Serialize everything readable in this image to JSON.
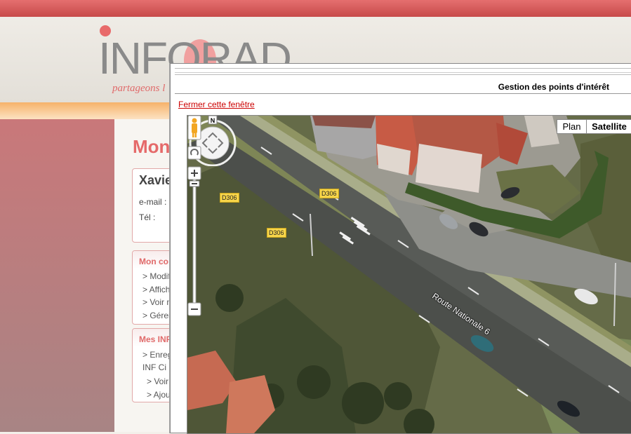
{
  "site": {
    "logo_text": "INFORAD",
    "tagline": "partageons l",
    "page_title": "Mon",
    "profile": {
      "name": "Xavie",
      "email_label": "e-mail :",
      "tel_label": "Tél :"
    },
    "account_box": {
      "title": "Mon co",
      "links": [
        "> Modif",
        "> Affich",
        "> Voir m",
        "> Gérer"
      ]
    },
    "inf_box": {
      "title": "Mes INF",
      "links": [
        "> Enreg",
        "INF Ci",
        "> Voir",
        "> Ajou"
      ]
    }
  },
  "popup": {
    "title": "Gestion des points d'intérêt",
    "close_link": "Fermer cette fenêtre"
  },
  "map": {
    "map_types": {
      "plan": "Plan",
      "satellite": "Satellite",
      "active": "Satellite"
    },
    "compass": "N",
    "road_labels": [
      "D306",
      "D306",
      "D306"
    ],
    "route_label": "Route Nationale 6",
    "marker_color": "#d9412b",
    "icons": [
      "pan-control-icon",
      "pegman-icon",
      "rotate-icon",
      "zoom-in-icon",
      "zoom-out-icon",
      "map-marker-icon"
    ]
  },
  "colors": {
    "brand": "#e56a6a",
    "link": "#cc0000",
    "band": "#f6b26a"
  }
}
